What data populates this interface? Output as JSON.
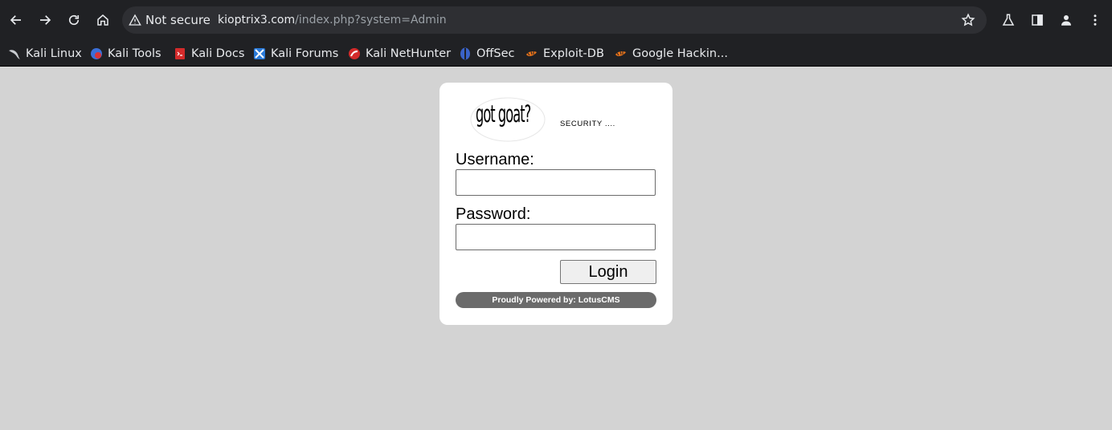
{
  "browser": {
    "security_text": "Not secure",
    "url_host": "kioptrix3.com",
    "url_path": "/index.php?system=Admin",
    "bookmarks": [
      {
        "label": "Kali Linux",
        "icon": "kali-dragon-icon"
      },
      {
        "label": "Kali Tools",
        "icon": "kali-tools-icon"
      },
      {
        "label": "Kali Docs",
        "icon": "kali-docs-icon"
      },
      {
        "label": "Kali Forums",
        "icon": "kali-forums-icon"
      },
      {
        "label": "Kali NetHunter",
        "icon": "kali-nethunter-icon"
      },
      {
        "label": "OffSec",
        "icon": "offsec-icon"
      },
      {
        "label": "Exploit-DB",
        "icon": "exploit-db-icon"
      },
      {
        "label": "Google Hackin...",
        "icon": "exploit-db-icon"
      }
    ]
  },
  "page": {
    "logo_text": "got goat?",
    "tagline": "SECURITY ....",
    "username_label": "Username:",
    "username_value": "",
    "password_label": "Password:",
    "password_value": "",
    "login_label": "Login",
    "footer_text": "Proudly Powered by: LotusCMS"
  },
  "colors": {
    "page_background": "#d3d3d3",
    "chrome_background": "#202124",
    "footer_bar": "#6b6b6b"
  }
}
